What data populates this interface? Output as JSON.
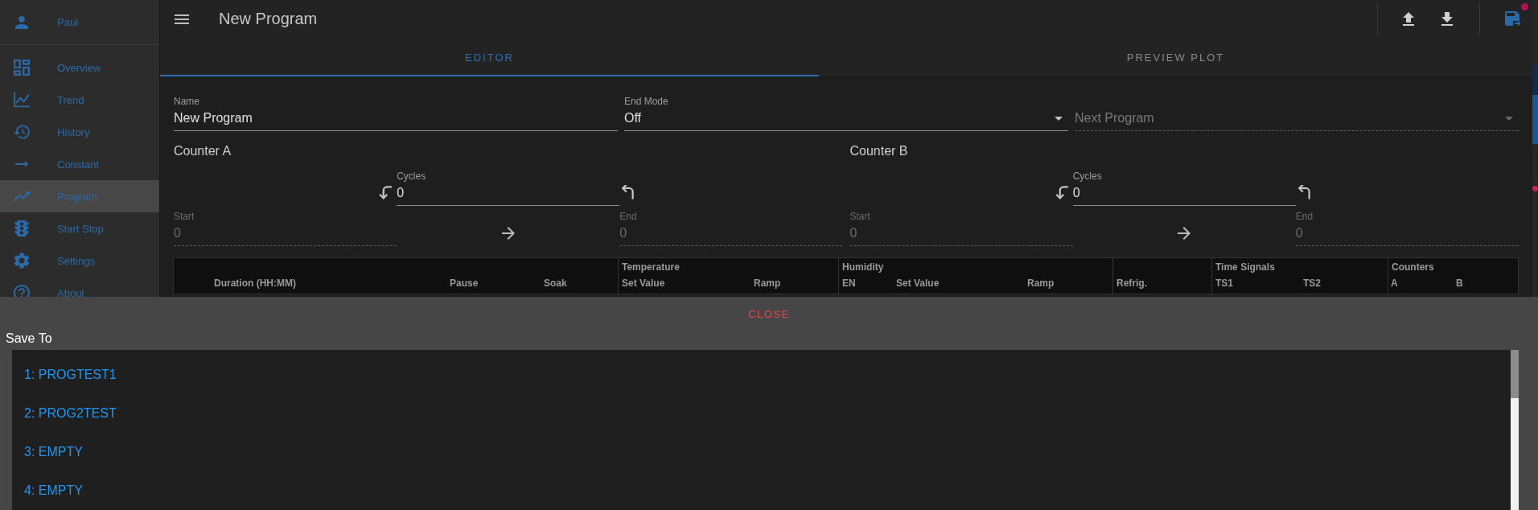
{
  "sidebar": {
    "user": {
      "name": "Paul"
    },
    "items": [
      {
        "label": "Overview",
        "selected": false
      },
      {
        "label": "Trend",
        "selected": false
      },
      {
        "label": "History",
        "selected": false
      },
      {
        "label": "Constant",
        "selected": false
      },
      {
        "label": "Program",
        "selected": true
      },
      {
        "label": "Start Stop",
        "selected": false
      },
      {
        "label": "Settings",
        "selected": false
      },
      {
        "label": "About",
        "selected": false
      }
    ]
  },
  "top_bar": {
    "title": "New Program"
  },
  "tabs": [
    {
      "label": "EDITOR",
      "selected": true
    },
    {
      "label": "PREVIEW PLOT",
      "selected": false
    }
  ],
  "form": {
    "fields": [
      {
        "kind": "text",
        "label": "Name",
        "value": "New Program",
        "disabled": false
      },
      {
        "kind": "select",
        "label": "End Mode",
        "value": "Off",
        "disabled": false
      },
      {
        "kind": "select",
        "placeholder": "Next Program",
        "disabled": true
      }
    ]
  },
  "counters": [
    {
      "title": "Counter A",
      "cycles": {
        "label": "Cycles",
        "value": "0",
        "disabled": false
      },
      "start": {
        "label": "Start",
        "value": "0",
        "disabled": true
      },
      "end": {
        "label": "End",
        "value": "0",
        "disabled": true
      }
    },
    {
      "title": "Counter B",
      "cycles": {
        "label": "Cycles",
        "value": "0",
        "disabled": false
      },
      "start": {
        "label": "Start",
        "value": "0",
        "disabled": true
      },
      "end": {
        "label": "End",
        "value": "0",
        "disabled": true
      }
    }
  ],
  "table": {
    "column_groups": [
      {
        "columns": [
          "Duration (HH:MM)",
          "Pause",
          "Soak"
        ]
      },
      {
        "title": "Temperature",
        "columns": [
          "Set Value",
          "Ramp"
        ]
      },
      {
        "title": "Humidity",
        "columns": [
          "EN",
          "Set Value",
          "Ramp"
        ]
      },
      {
        "columns": [
          "Refrig."
        ]
      },
      {
        "title": "Time Signals",
        "columns": [
          "TS1",
          "TS2"
        ]
      },
      {
        "title": "Counters",
        "columns": [
          "A",
          "B"
        ]
      }
    ]
  },
  "dialog": {
    "close_label": "CLOSE",
    "title": "Save To",
    "slots": [
      {
        "label": "1: PROGTEST1",
        "selected": false
      },
      {
        "label": "2: PROG2TEST",
        "selected": false
      },
      {
        "label": "3: EMPTY",
        "selected": false
      },
      {
        "label": "4: EMPTY",
        "selected": false
      }
    ]
  }
}
